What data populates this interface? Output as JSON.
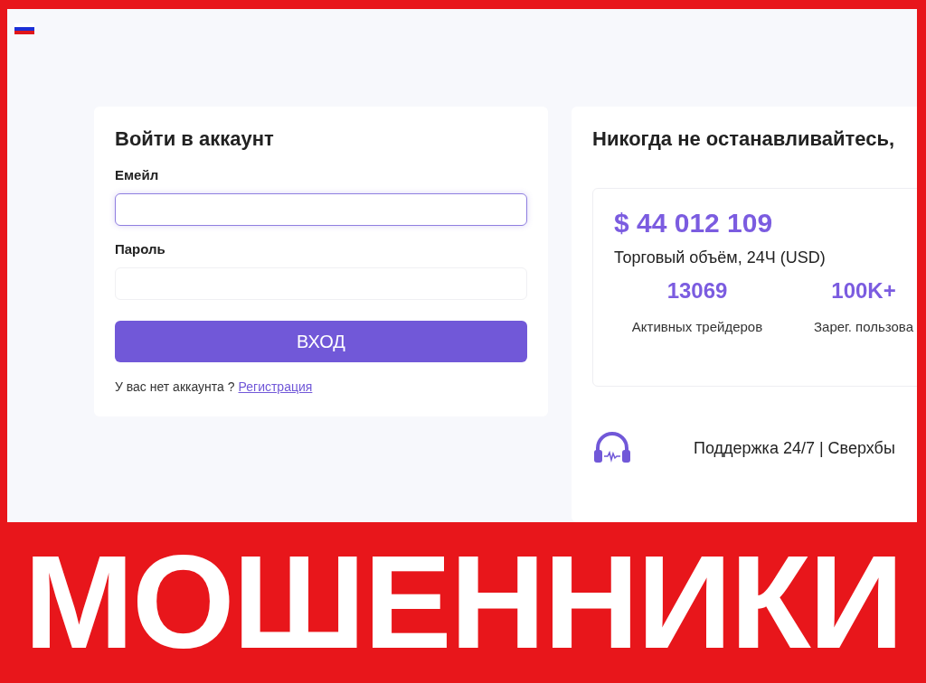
{
  "login": {
    "title": "Войти в аккаунт",
    "fields": [
      {
        "label": "Емейл",
        "focused": true
      },
      {
        "label": "Пароль",
        "focused": false
      }
    ],
    "submit": "ВХОД",
    "signup_prompt": "У вас нет аккаунта ?",
    "signup_link": "Регистрация"
  },
  "promo": {
    "title": "Никогда не останавливайтесь,",
    "volume": "$ 44 012 109",
    "volume_label": "Торговый объём, 24Ч (USD)",
    "stats": [
      {
        "value": "13069",
        "label": "Активных трейдеров"
      },
      {
        "value": "100K+",
        "label": "Зарег. пользова"
      }
    ],
    "support": "Поддержка 24/7 | Сверхбы"
  },
  "banner": "МОШЕННИКИ"
}
